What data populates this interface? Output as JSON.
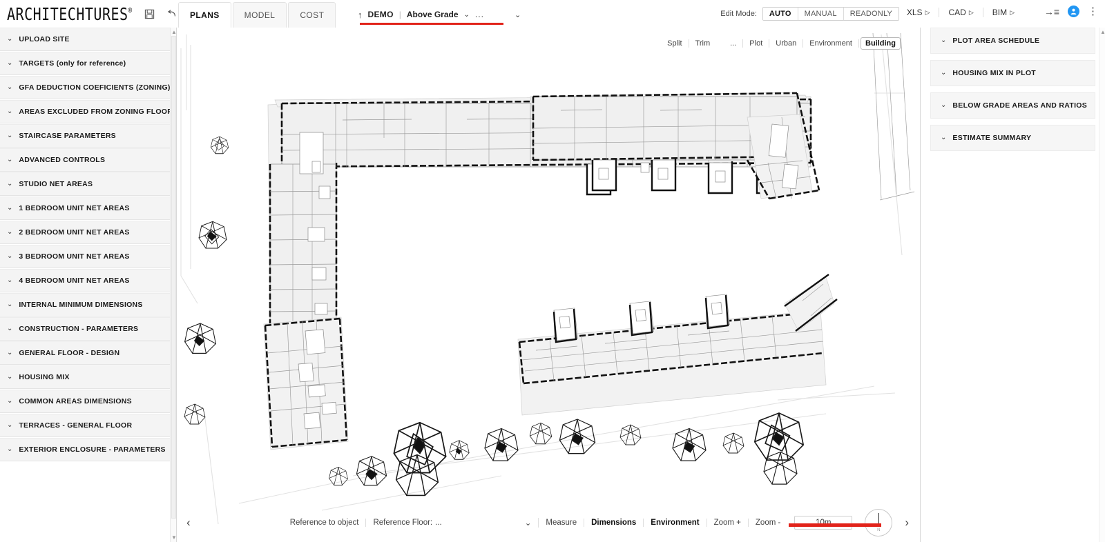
{
  "app": {
    "brand": "ARCHITECHTURES",
    "brand_mark": "®"
  },
  "toolbar": {
    "save_icon": "save-icon",
    "undo_icon": "undo-icon",
    "redo_icon": "redo-icon",
    "tabs": [
      {
        "label": "PLANS",
        "active": true
      },
      {
        "label": "MODEL",
        "active": false
      },
      {
        "label": "COST",
        "active": false
      }
    ],
    "project": {
      "upload_arrow": "↑",
      "name": "DEMO",
      "divider": "|",
      "grade": "Above Grade",
      "grade_caret": "⌄",
      "ellipsis": "...",
      "end_caret": "⌄"
    },
    "edit_mode": {
      "label": "Edit Mode:",
      "options": [
        {
          "label": "AUTO",
          "active": true
        },
        {
          "label": "MANUAL",
          "active": false
        },
        {
          "label": "READONLY",
          "active": false
        }
      ]
    },
    "exports": [
      {
        "label": "XLS",
        "icon": "play-triangle-icon"
      },
      {
        "label": "CAD",
        "icon": "play-triangle-icon"
      },
      {
        "label": "BIM",
        "icon": "play-triangle-icon"
      }
    ],
    "right_glyphs": {
      "collapse_panel_icon": "collapse-panel-icon",
      "collapse_panel_glyph": "→≡",
      "avatar_icon": "user-avatar-icon",
      "more_icon": "kebab-menu-icon",
      "more_glyph": "⋮"
    },
    "accent_color": "#e2231a"
  },
  "sidebar": {
    "items": [
      {
        "label": "UPLOAD SITE"
      },
      {
        "label": "TARGETS (only for reference)"
      },
      {
        "label": "GFA DEDUCTION COEFICIENTS (ZONING)"
      },
      {
        "label": "AREAS EXCLUDED FROM ZONING FLOOR AREA"
      },
      {
        "label": "STAIRCASE PARAMETERS"
      },
      {
        "label": "ADVANCED CONTROLS"
      },
      {
        "label": "STUDIO NET AREAS"
      },
      {
        "label": "1 BEDROOM UNIT NET AREAS"
      },
      {
        "label": "2 BEDROOM UNIT NET AREAS"
      },
      {
        "label": "3 BEDROOM UNIT NET AREAS"
      },
      {
        "label": "4 BEDROOM UNIT NET AREAS"
      },
      {
        "label": "INTERNAL MINIMUM DIMENSIONS"
      },
      {
        "label": "CONSTRUCTION - PARAMETERS"
      },
      {
        "label": "GENERAL FLOOR - DESIGN"
      },
      {
        "label": "HOUSING MIX"
      },
      {
        "label": "COMMON AREAS DIMENSIONS"
      },
      {
        "label": "TERRACES - GENERAL FLOOR"
      },
      {
        "label": "EXTERIOR ENCLOSURE - PARAMETERS"
      }
    ],
    "chevron": "⌄"
  },
  "canvas": {
    "view_tools": [
      {
        "label": "Split",
        "active": false,
        "boxed": false
      },
      {
        "label": "Trim",
        "active": false,
        "boxed": false
      },
      {
        "label": "...",
        "active": false,
        "boxed": false
      },
      {
        "label": "Plot",
        "active": false,
        "boxed": false
      },
      {
        "label": "Urban",
        "active": false,
        "boxed": false
      },
      {
        "label": "Environment",
        "active": false,
        "boxed": false
      },
      {
        "label": "Building",
        "active": true,
        "boxed": true
      }
    ],
    "bottom_tools": {
      "reference_to_object": "Reference to object",
      "reference_floor_label": "Reference Floor:",
      "reference_floor_value": "...",
      "reference_floor_caret": "⌄",
      "measure": "Measure",
      "dimensions": "Dimensions",
      "environment": "Environment",
      "zoom_in": "Zoom +",
      "zoom_out": "Zoom -",
      "scale_value": "10m",
      "prev_arrow": "‹",
      "next_arrow": "›",
      "compass_icon": "north-compass-icon",
      "compass_label": "N"
    }
  },
  "right_panel": {
    "items": [
      {
        "label": "PLOT AREA SCHEDULE"
      },
      {
        "label": "HOUSING MIX IN PLOT"
      },
      {
        "label": "BELOW GRADE AREAS AND RATIOS"
      },
      {
        "label": "ESTIMATE SUMMARY"
      }
    ],
    "chevron": "⌄"
  }
}
